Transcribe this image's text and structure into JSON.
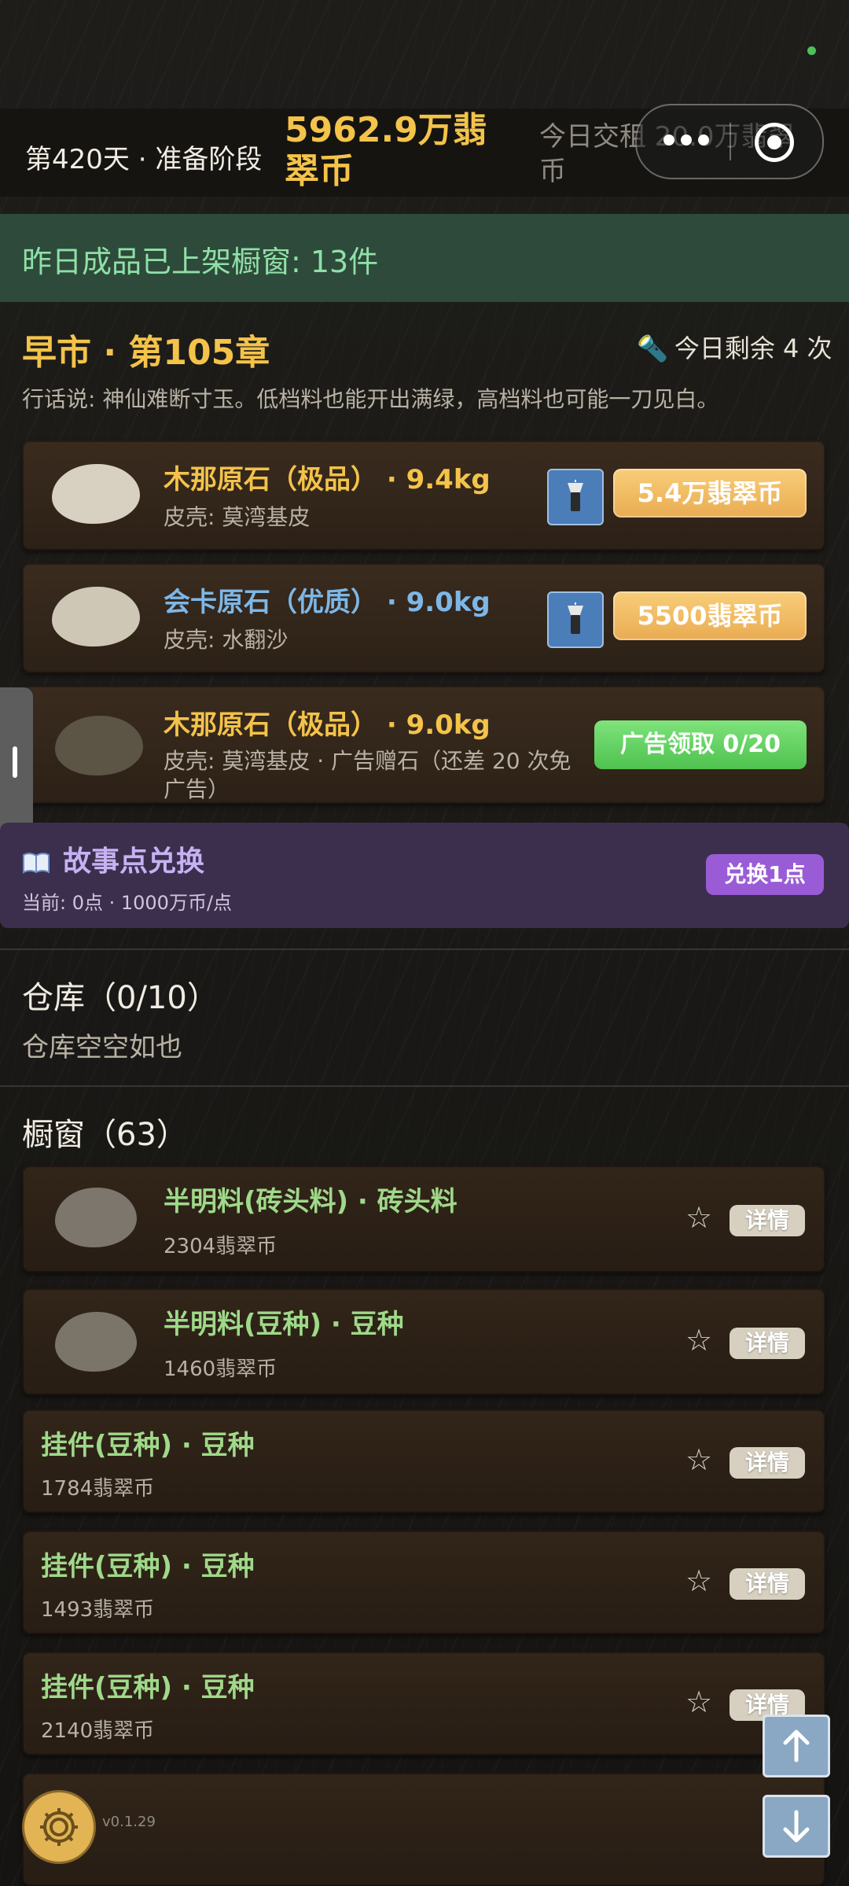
{
  "header": {
    "day_phase": "第420天 · 准备阶段",
    "coins": "5962.9万翡翠币",
    "rent": "今日交租 20.0万翡翠币"
  },
  "banner": {
    "text": "昨日成品已上架橱窗: 13件"
  },
  "market": {
    "title": "早市 · 第105章",
    "remaining": "今日剩余 4 次",
    "saying": "行话说: 神仙难断寸玉。低档料也能开出满绿，高档料也可能一刀见白。",
    "items": [
      {
        "title": "木那原石（极品） · 9.4kg",
        "sub": "皮壳: 莫湾基皮",
        "price": "5.4万翡翠币"
      },
      {
        "title": "会卡原石（优质） · 9.0kg",
        "sub": "皮壳: 水翻沙",
        "price": "5500翡翠币"
      },
      {
        "title": "木那原石（极品） · 9.0kg",
        "sub": "皮壳: 莫湾基皮 · 广告赠石（还差 20 次免广告）",
        "button": "广告领取 0/20"
      }
    ]
  },
  "story": {
    "title": "故事点兑换",
    "sub": "当前: 0点 · 1000万币/点",
    "button": "兑换1点"
  },
  "warehouse": {
    "title": "仓库（0/10）",
    "empty": "仓库空空如也"
  },
  "showcase": {
    "title": "橱窗（63）",
    "detail_label": "详情",
    "items": [
      {
        "title": "半明料(砖头料) · 砖头料",
        "price": "2304翡翠币"
      },
      {
        "title": "半明料(豆种) · 豆种",
        "price": "1460翡翠币"
      },
      {
        "title": "挂件(豆种) · 豆种",
        "price": "1784翡翠币"
      },
      {
        "title": "挂件(豆种) · 豆种",
        "price": "1493翡翠币"
      },
      {
        "title": "挂件(豆种) · 豆种",
        "price": "2140翡翠币"
      }
    ]
  },
  "footer": {
    "version": "v0.1.29"
  },
  "colors": {
    "gold": "#f3c34a",
    "green": "#9fd98a",
    "blue": "#7db7e8",
    "purple": "#9a5cd6"
  }
}
